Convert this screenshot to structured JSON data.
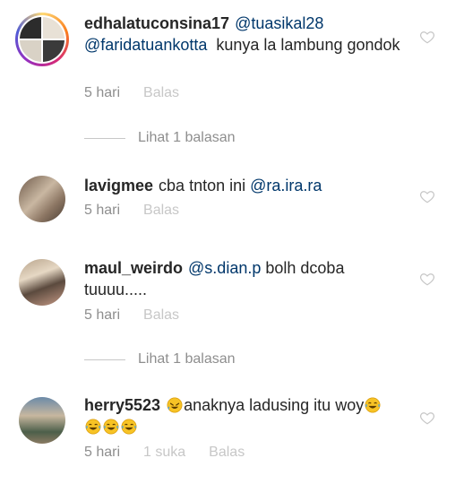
{
  "comments": [
    {
      "username": "edhalatuconsina17",
      "mentions": [
        "@tuasikal28",
        "@faridatuankotta"
      ],
      "text": "kunya la lambung gondok",
      "time": "5 hari",
      "reply_label": "Balas",
      "view_replies": "Lihat 1 balasan"
    },
    {
      "username": "lavigmee",
      "text": "cba tnton ini",
      "mention": "@ra.ira.ra",
      "time": "5 hari",
      "reply_label": "Balas"
    },
    {
      "username": "maul_weirdo",
      "mention": "@s.dian.p",
      "text": "bolh dcoba tuuuu.....",
      "time": "5 hari",
      "reply_label": "Balas",
      "view_replies": "Lihat 1 balasan"
    },
    {
      "username": "herry5523",
      "text": "anaknya ladusing itu woy",
      "time": "5 hari",
      "likes": "1 suka",
      "reply_label": "Balas"
    }
  ]
}
